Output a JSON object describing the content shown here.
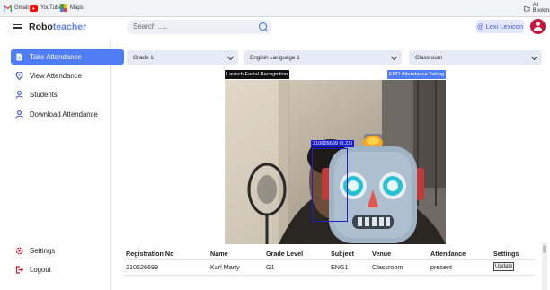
{
  "bookmarks": [
    {
      "label": "Gmail",
      "icon": "gmail-icon",
      "color": "#ea4335"
    },
    {
      "label": "YouTube",
      "icon": "youtube-icon",
      "color": "#ff0000"
    },
    {
      "label": "Maps",
      "icon": "maps-icon",
      "color": "#34a853"
    }
  ],
  "bookmarks_right": {
    "label": "All Bookmarks",
    "icon": "folder-icon"
  },
  "header": {
    "brand_prefix": "Robo",
    "brand_suffix": "teacher",
    "search_placeholder": "Search .....",
    "user_name": "Lexi Lexicon",
    "accent_color": "#4f7df3",
    "avatar_color": "#c8143b"
  },
  "sidebar": {
    "items": [
      {
        "label": "Take Attendance",
        "icon": "document-icon",
        "active": true
      },
      {
        "label": "View Attendance",
        "icon": "location-pin-icon",
        "active": false
      },
      {
        "label": "Students",
        "icon": "person-icon",
        "active": false
      },
      {
        "label": "Download Attendance",
        "icon": "person-icon",
        "active": false
      }
    ],
    "bottom_items": [
      {
        "label": "Settings",
        "icon": "gear-icon"
      },
      {
        "label": "Logout",
        "icon": "logout-icon"
      }
    ]
  },
  "filters": {
    "grade": "Grade 1",
    "subject": "English Language 1",
    "venue": "Classroom"
  },
  "controls": {
    "launch_label": "Launch Facial Recognition",
    "end_label": "END Attendance Taking"
  },
  "camera": {
    "detection_label": "210626699 (0.21)"
  },
  "table": {
    "headers": [
      "Registration No",
      "Name",
      "Grade Level",
      "Subject",
      "Venue",
      "Attendance",
      "Settings"
    ],
    "rows": [
      {
        "reg": "210626699",
        "name": "Karl Marty",
        "grade": "G1",
        "subject": "ENG1",
        "venue": "Classroom",
        "attendance": "present",
        "action": "Update"
      }
    ]
  }
}
